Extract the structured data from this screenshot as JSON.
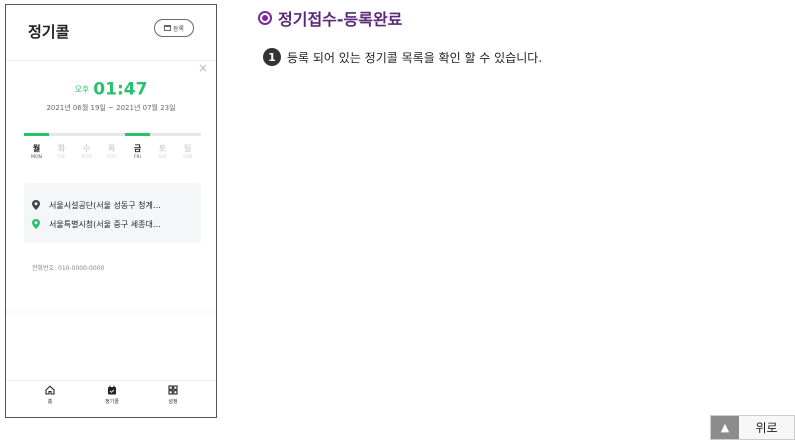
{
  "phone": {
    "title": "정기콜",
    "register_button": "등록",
    "close_symbol": "×",
    "time": {
      "ampm": "오후",
      "clock": "01:47"
    },
    "date_range": "2021년 06월 19일 ~ 2021년 07월 23일",
    "days": [
      {
        "ko": "월",
        "en": "MON",
        "selected": true
      },
      {
        "ko": "화",
        "en": "TUE",
        "selected": false
      },
      {
        "ko": "수",
        "en": "WED",
        "selected": false
      },
      {
        "ko": "목",
        "en": "THU",
        "selected": false
      },
      {
        "ko": "금",
        "en": "FRI",
        "selected": true
      },
      {
        "ko": "토",
        "en": "SAT",
        "selected": false
      },
      {
        "ko": "일",
        "en": "SUN",
        "selected": false
      }
    ],
    "route": {
      "origin": "서울시설공단(서울 성동구 청계…",
      "destination": "서울특별시청(서울 중구 세종대…"
    },
    "phone_number": "전화번호: 010-0000-0000",
    "nav": [
      {
        "label": "홈",
        "icon": "home-icon"
      },
      {
        "label": "정기콜",
        "icon": "calendar-icon"
      },
      {
        "label": "설정",
        "icon": "grid-icon"
      }
    ]
  },
  "section": {
    "title": "정기접수-등록완료",
    "step_number": "1",
    "description": "등록 되어 있는 정기콜 목록을 확인 할 수 있습니다."
  },
  "top_button": {
    "label": "위로",
    "arrow": "▲"
  },
  "colors": {
    "accent_green": "#27c26a",
    "title_purple": "#5a2a7a",
    "radio_purple": "#7b2a9c"
  }
}
